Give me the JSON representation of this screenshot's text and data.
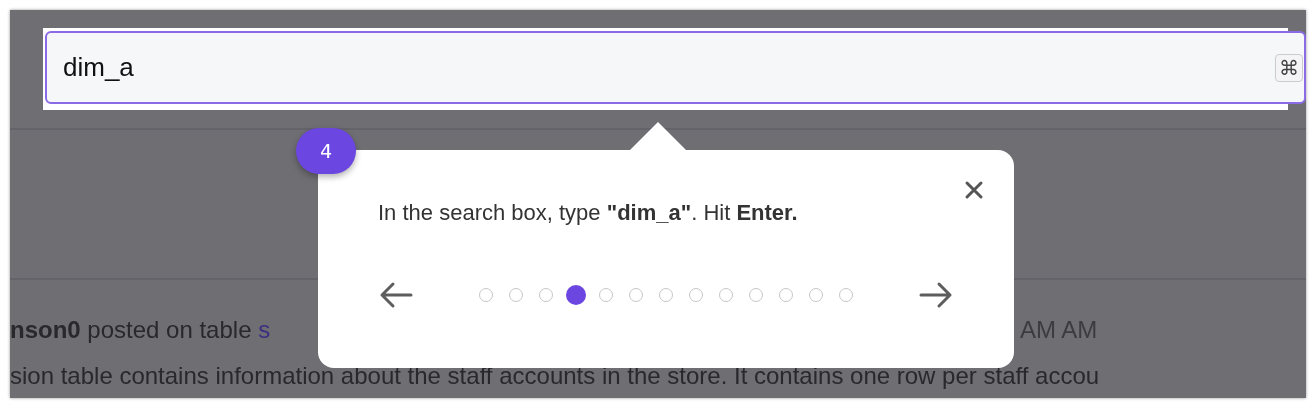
{
  "search": {
    "value": "dim_a",
    "shortcut_key": "⌘"
  },
  "tour": {
    "step": "4",
    "message": "In the search box, type **\"dim_a\"**. Hit **Enter.**",
    "steps": [
      {
        "selected": false
      },
      {
        "selected": false
      },
      {
        "selected": false
      },
      {
        "selected": true
      },
      {
        "selected": false
      },
      {
        "selected": false
      },
      {
        "selected": false
      },
      {
        "selected": false
      },
      {
        "selected": false
      },
      {
        "selected": false
      },
      {
        "selected": false
      },
      {
        "selected": false
      },
      {
        "selected": false
      }
    ]
  },
  "feed": {
    "author": "nson0",
    "action": "posted on table",
    "table_link": "s",
    "time": "AM AM",
    "description": "sion table contains information about the staff accounts in the store. It contains one row per staff accou"
  }
}
